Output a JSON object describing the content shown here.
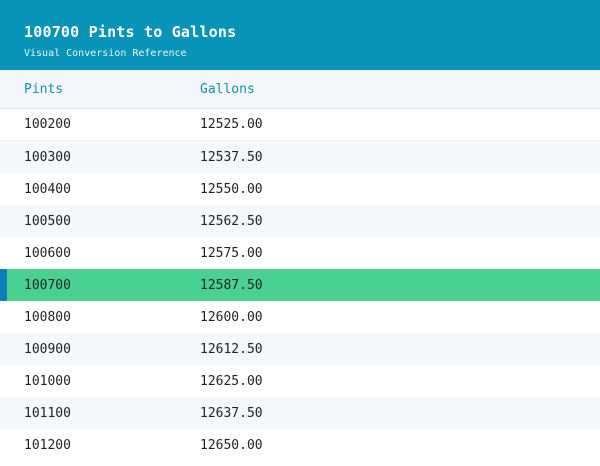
{
  "header": {
    "title": "100700 Pints to Gallons",
    "subtitle": "Visual Conversion Reference"
  },
  "table": {
    "columns": [
      "Pints",
      "Gallons"
    ],
    "highlight_index": 5,
    "rows": [
      {
        "pints": "100200",
        "gallons": "12525.00"
      },
      {
        "pints": "100300",
        "gallons": "12537.50"
      },
      {
        "pints": "100400",
        "gallons": "12550.00"
      },
      {
        "pints": "100500",
        "gallons": "12562.50"
      },
      {
        "pints": "100600",
        "gallons": "12575.00"
      },
      {
        "pints": "100700",
        "gallons": "12587.50"
      },
      {
        "pints": "100800",
        "gallons": "12600.00"
      },
      {
        "pints": "100900",
        "gallons": "12612.50"
      },
      {
        "pints": "101000",
        "gallons": "12625.00"
      },
      {
        "pints": "101100",
        "gallons": "12637.50"
      },
      {
        "pints": "101200",
        "gallons": "12650.00"
      }
    ]
  },
  "colors": {
    "header_bg": "#0893b8",
    "highlight_bg": "#48d191",
    "highlight_marker": "#0e7fb8",
    "accent_text": "#0e8fae"
  }
}
